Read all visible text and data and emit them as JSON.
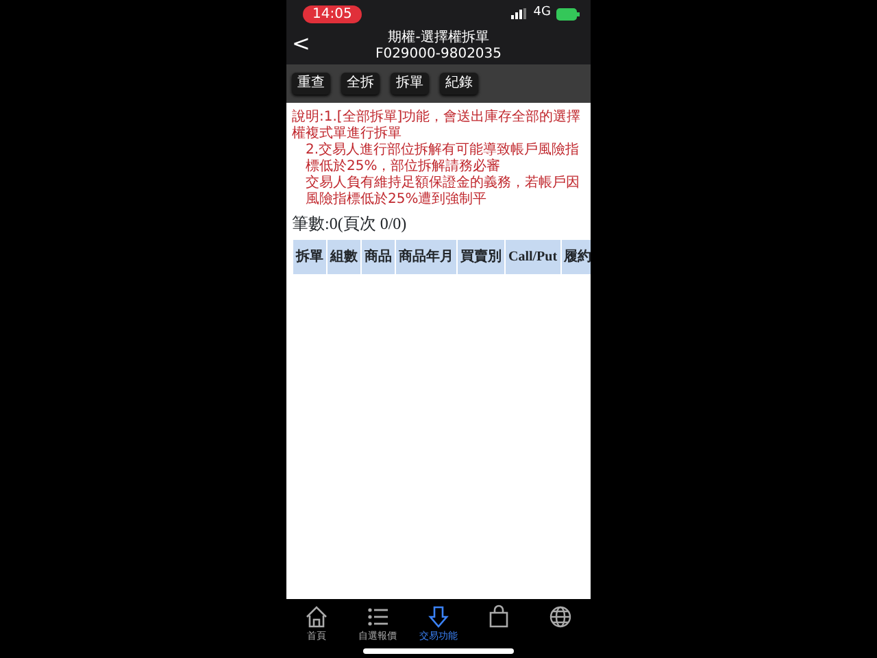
{
  "status_bar": {
    "time": "14:05",
    "network": "4G"
  },
  "header": {
    "title": "期權-選擇權拆單",
    "subtitle": "F029000-9802035",
    "back": "<"
  },
  "toolbar": [
    "重查",
    "全拆",
    "拆單",
    "紀錄"
  ],
  "notes": [
    "說明:1.[全部拆單]功能，會送出庫存全部的選擇權複式單進行拆單",
    "2.交易人進行部位拆解有可能導致帳戶風險指標低於25%，部位拆解請務必審",
    "交易人負有維持足額保證金的義務，若帳戶因風險指標低於25%遭到強制平"
  ],
  "count": "筆數:0(頁次 0/0)",
  "table": {
    "columns": [
      "拆單",
      "組數",
      "商品",
      "商品年月",
      "買賣別",
      "Call/Put",
      "履約"
    ]
  },
  "tab_bar": [
    {
      "kind": "home",
      "label": "首頁",
      "selected": false
    },
    {
      "kind": "list",
      "label": "自選報價",
      "selected": false
    },
    {
      "kind": "trade",
      "label": "交易功能",
      "selected": true
    },
    {
      "kind": "bag",
      "selected": false
    },
    {
      "kind": "globe",
      "selected": false
    }
  ]
}
